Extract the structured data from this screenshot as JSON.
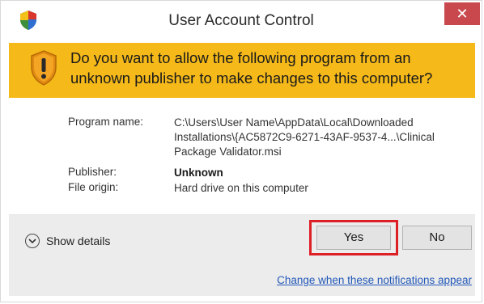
{
  "window": {
    "title": "User Account Control",
    "close_glyph": "✕",
    "icon": "uac-shield-icon"
  },
  "banner": {
    "question": "Do you want to allow the following program from an unknown publisher to make changes to this computer?",
    "icon": "warning-shield-icon",
    "color": "#f5b919"
  },
  "details": {
    "program_name_label": "Program name:",
    "program_name_line1": "C:\\Users\\User Name\\AppData\\Local\\Downloaded",
    "program_name_line2": "Installations\\{AC5872C9-6271-43AF-9537-4...\\Clinical",
    "program_name_line3": "Package Validator.msi",
    "publisher_label": "Publisher:",
    "publisher_value": "Unknown",
    "file_origin_label": "File origin:",
    "file_origin_value": "Hard drive on this computer"
  },
  "footer": {
    "show_details_label": "Show details",
    "yes_label": "Yes",
    "no_label": "No",
    "change_link": "Change when these notifications appear",
    "highlight_color": "#dd1f26"
  }
}
